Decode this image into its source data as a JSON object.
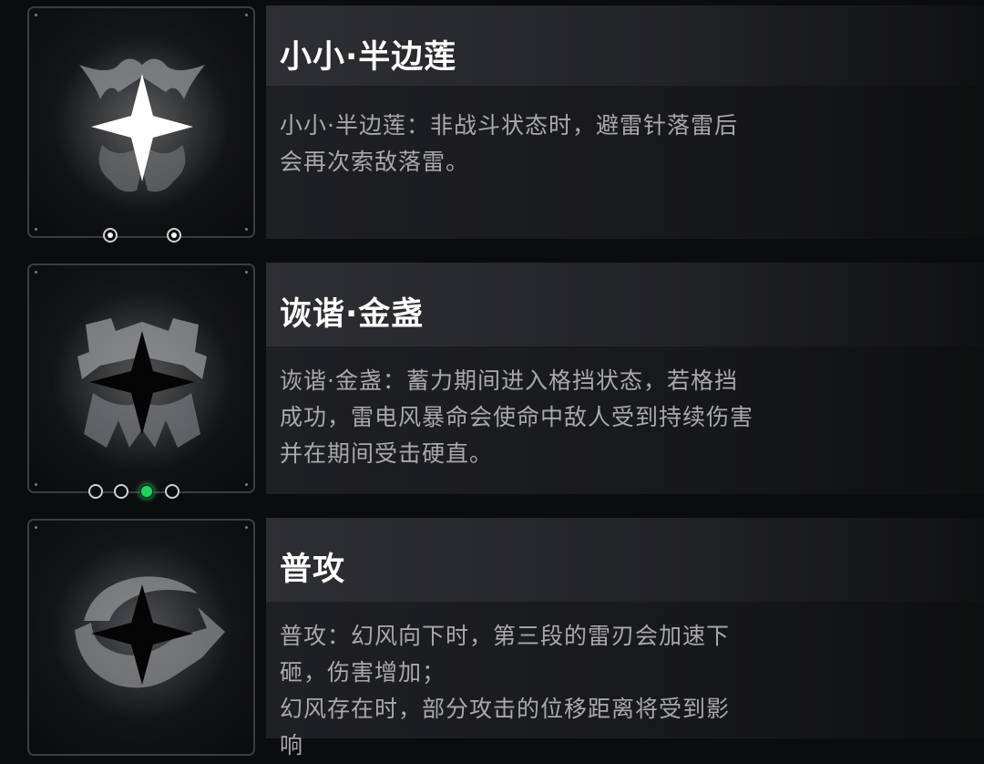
{
  "skills": [
    {
      "title": "小小·半边莲",
      "description": "小小·半边莲：非战斗状态时，避雷针落雷后\n会再次索敌落雷。",
      "icon": "bright-star-emblem-icon",
      "dots": [
        "filled",
        "filled"
      ]
    },
    {
      "title": "诙谐·金盏",
      "description": "诙谐·金盏：蓄力期间进入格挡状态，若格挡\n成功，雷电风暴命会使命中敌人受到持续伤害\n并在期间受击硬直。",
      "icon": "dark-star-emblem-icon",
      "dots": [
        "empty",
        "empty",
        "active",
        "empty"
      ]
    },
    {
      "title": "普攻",
      "description": "普攻：幻风向下时，第三段的雷刃会加速下\n砸，伤害增加；\n幻风存在时，部分攻击的位移距离将受到影\n响",
      "icon": "dark-star-wind-icon",
      "dots": []
    }
  ],
  "colors": {
    "active_dot": "#1ed760",
    "title": "#ffffff",
    "desc": "#a9a9ab"
  }
}
